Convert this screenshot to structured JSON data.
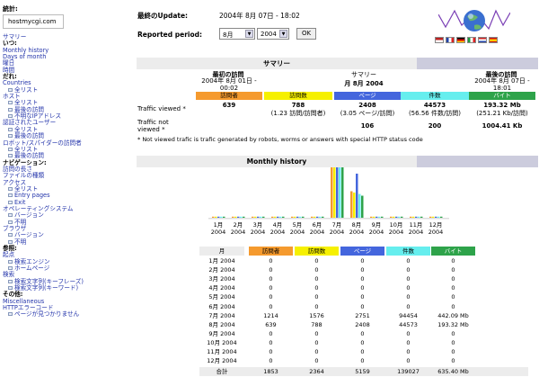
{
  "menu": {
    "stats_title": "統計:",
    "site": "hostmycgi.com",
    "items": [
      {
        "t": "サマリー",
        "k": "l"
      },
      {
        "t": "いつ:",
        "k": "h"
      },
      {
        "t": "Monthly history",
        "k": "l"
      },
      {
        "t": "Days of month",
        "k": "l"
      },
      {
        "t": "曜日",
        "k": "l"
      },
      {
        "t": "時間",
        "k": "l"
      },
      {
        "t": "だれ:",
        "k": "h"
      },
      {
        "t": "Countries",
        "k": "l"
      },
      {
        "t": "全リスト",
        "k": "s"
      },
      {
        "t": "ホスト",
        "k": "l"
      },
      {
        "t": "全リスト",
        "k": "s"
      },
      {
        "t": "最後の訪問",
        "k": "s"
      },
      {
        "t": "不明なIPアドレス",
        "k": "s"
      },
      {
        "t": "認証されたユーザー",
        "k": "l"
      },
      {
        "t": "全リスト",
        "k": "s"
      },
      {
        "t": "最後の訪問",
        "k": "s"
      },
      {
        "t": "ロボット/スパイダーの訪問者",
        "k": "l"
      },
      {
        "t": "全リスト",
        "k": "s"
      },
      {
        "t": "最後の訪問",
        "k": "s"
      },
      {
        "t": "ナビゲーション:",
        "k": "h"
      },
      {
        "t": "訪問の長さ",
        "k": "l"
      },
      {
        "t": "ファイルの種類",
        "k": "l"
      },
      {
        "t": "アクセス",
        "k": "l"
      },
      {
        "t": "全リスト",
        "k": "s"
      },
      {
        "t": "Entry pages",
        "k": "s"
      },
      {
        "t": "Exit",
        "k": "s"
      },
      {
        "t": "オペレーティングシステム",
        "k": "l"
      },
      {
        "t": "バージョン",
        "k": "s"
      },
      {
        "t": "不明",
        "k": "s"
      },
      {
        "t": "ブラウザ",
        "k": "l"
      },
      {
        "t": "バージョン",
        "k": "s"
      },
      {
        "t": "不明",
        "k": "s"
      },
      {
        "t": "参照:",
        "k": "h"
      },
      {
        "t": "起点",
        "k": "l"
      },
      {
        "t": "検索エンジン",
        "k": "s"
      },
      {
        "t": "ホームページ",
        "k": "s"
      },
      {
        "t": "検索",
        "k": "l"
      },
      {
        "t": "検索文字列(キーフレーズ)",
        "k": "s"
      },
      {
        "t": "検索文字列(キーワード)",
        "k": "s"
      },
      {
        "t": "その他:",
        "k": "h"
      },
      {
        "t": "Miscellaneous",
        "k": "l"
      },
      {
        "t": "HTTPエラーコード",
        "k": "l"
      },
      {
        "t": "ページが見つかりません",
        "k": "s"
      }
    ]
  },
  "header": {
    "last_update_label": "最終のUpdate:",
    "last_update_value": "2004年 8月 07日 - 18:02",
    "period_label": "Reported period:",
    "month_select": "8月",
    "year_select": "2004",
    "ok_label": "OK"
  },
  "summary": {
    "title": "サマリー",
    "first_visit_label": "最初の訪問",
    "first_visit_value": "2004年 8月 01日 - 00:02",
    "center_label": "サマリー",
    "center_month": "月 8月 2004",
    "last_visit_label": "最後の訪問",
    "last_visit_value": "2004年 8月 07日 - 18:01",
    "col_headers": [
      "訪問者",
      "訪問数",
      "ページ",
      "件数",
      "バイト"
    ],
    "viewed_label": "Traffic viewed *",
    "viewed": {
      "visitors": "639",
      "visits": "788",
      "visits_sub": "(1.23 訪問/訪問者)",
      "pages": "2408",
      "pages_sub": "(3.05 ページ/訪問)",
      "hits": "44573",
      "hits_sub": "(56.56 件数/訪問)",
      "bytes": "193.32 Mb",
      "bytes_sub": "(251.21 Kb/訪問)"
    },
    "not_viewed_label_1": "Traffic not",
    "not_viewed_label_2": "viewed *",
    "not_viewed": {
      "pages": "106",
      "hits": "200",
      "bytes": "1004.41 Kb"
    },
    "footnote": "* Not viewed trafic is trafic generated by robots, worms or answers with special HTTP status code"
  },
  "monthly": {
    "title": "Monthly history",
    "months": [
      "1月",
      "2月",
      "3月",
      "4月",
      "5月",
      "6月",
      "7月",
      "8月",
      "9月",
      "10月",
      "11月",
      "12月"
    ],
    "year": "2004",
    "col_month": "月",
    "col_headers": [
      "訪問者",
      "訪問数",
      "ページ",
      "件数",
      "バイト"
    ],
    "rows": [
      [
        "1月 2004",
        "0",
        "0",
        "0",
        "0",
        "0"
      ],
      [
        "2月 2004",
        "0",
        "0",
        "0",
        "0",
        "0"
      ],
      [
        "3月 2004",
        "0",
        "0",
        "0",
        "0",
        "0"
      ],
      [
        "4月 2004",
        "0",
        "0",
        "0",
        "0",
        "0"
      ],
      [
        "5月 2004",
        "0",
        "0",
        "0",
        "0",
        "0"
      ],
      [
        "6月 2004",
        "0",
        "0",
        "0",
        "0",
        "0"
      ],
      [
        "7月 2004",
        "1214",
        "1576",
        "2751",
        "94454",
        "442.09 Mb"
      ],
      [
        "8月 2004",
        "639",
        "788",
        "2408",
        "44573",
        "193.32 Mb"
      ],
      [
        "9月 2004",
        "0",
        "0",
        "0",
        "0",
        "0"
      ],
      [
        "10月 2004",
        "0",
        "0",
        "0",
        "0",
        "0"
      ],
      [
        "11月 2004",
        "0",
        "0",
        "0",
        "0",
        "0"
      ],
      [
        "12月 2004",
        "0",
        "0",
        "0",
        "0",
        "0"
      ]
    ],
    "total": [
      "合計",
      "1853",
      "2364",
      "5159",
      "139027",
      "635.40 Mb"
    ]
  },
  "colors": {
    "visitors": "#f59a2e",
    "visits": "#f6f000",
    "pages": "#4466dd",
    "hits": "#66eeee",
    "bytes": "#2ea34a",
    "bar_header": "#ccccdd"
  },
  "chart_data": {
    "type": "bar",
    "categories": [
      "1月 2004",
      "2月 2004",
      "3月 2004",
      "4月 2004",
      "5月 2004",
      "6月 2004",
      "7月 2004",
      "8月 2004",
      "9月 2004",
      "10月 2004",
      "11月 2004",
      "12月 2004"
    ],
    "series": [
      {
        "name": "訪問者",
        "values": [
          0,
          0,
          0,
          0,
          0,
          0,
          1214,
          639,
          0,
          0,
          0,
          0
        ]
      },
      {
        "name": "訪問数",
        "values": [
          0,
          0,
          0,
          0,
          0,
          0,
          1576,
          788,
          0,
          0,
          0,
          0
        ]
      },
      {
        "name": "ページ",
        "values": [
          0,
          0,
          0,
          0,
          0,
          0,
          2751,
          2408,
          0,
          0,
          0,
          0
        ]
      },
      {
        "name": "件数",
        "values": [
          0,
          0,
          0,
          0,
          0,
          0,
          94454,
          44573,
          0,
          0,
          0,
          0
        ]
      },
      {
        "name": "バイト",
        "values": [
          0,
          0,
          0,
          0,
          0,
          0,
          442.09,
          193.32,
          0,
          0,
          0,
          0
        ]
      }
    ]
  }
}
